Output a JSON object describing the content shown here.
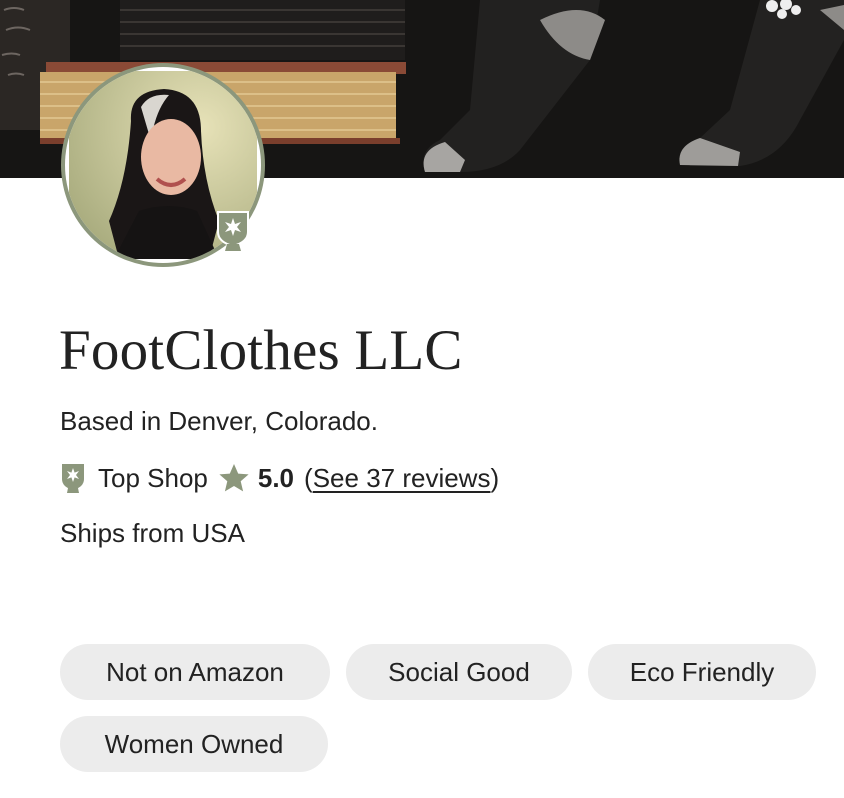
{
  "shop": {
    "name": "FootClothes LLC",
    "location": "Based in Denver, Colorado.",
    "badge_label": "Top Shop",
    "rating": "5.0",
    "reviews_open": "(",
    "reviews_link": "See 37 reviews",
    "reviews_close": ")",
    "ships_from": "Ships from USA"
  },
  "tags": [
    {
      "label": "Not on Amazon"
    },
    {
      "label": "Social Good"
    },
    {
      "label": "Eco Friendly"
    },
    {
      "label": "Women Owned"
    }
  ],
  "icons": {
    "badge": "top-shop-badge-icon",
    "star": "star-icon"
  },
  "colors": {
    "accent_green": "#8c977c",
    "tag_bg": "#ececec",
    "text": "#222222",
    "banner_bg": "#151413"
  }
}
